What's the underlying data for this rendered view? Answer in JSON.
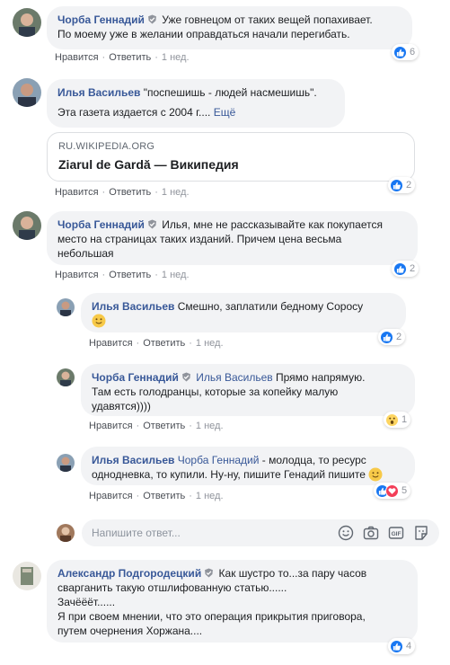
{
  "actions": {
    "like": "Нравится",
    "reply": "Ответить",
    "sep": "·"
  },
  "comments": [
    {
      "author": "Чорба Геннадий",
      "verified": true,
      "lines": [
        "Уже говнецом от таких вещей попахивает.",
        "По моему уже в желании оправдаться начали перегибать."
      ],
      "time": "1 нед.",
      "reaction_count": "6"
    },
    {
      "author": "Илья Васильев",
      "text1": "\"поспешишь - людей насмешишь\".",
      "text2": "Эта газета издается с 2004 г....",
      "more": "Ещё",
      "link": {
        "domain": "RU.WIKIPEDIA.ORG",
        "title": "Ziarul de Gardă — Википедия"
      },
      "time": "1 нед.",
      "reaction_count": "2"
    },
    {
      "author": "Чорба Геннадий",
      "verified": true,
      "line1": "Илья, мне не рассказывайте как покупается",
      "line2": "место на страницах таких изданий. Причем цена весьма",
      "line3": "небольшая",
      "time": "1 нед.",
      "reaction_count": "2"
    }
  ],
  "replies": [
    {
      "author": "Илья Васильев",
      "line1": "Смешно, заплатили бедному Соросу",
      "emoji": "slight-smile",
      "time": "1 нед.",
      "reaction_count": "2"
    },
    {
      "author": "Чорба Геннадий",
      "verified": true,
      "mention": "Илья Васильев",
      "line1": "Прямо напрямую.",
      "line2": "Там есть голодранцы, которые за копейку малую",
      "line3": "удавятся))))",
      "time": "1 нед.",
      "reaction_count": "1"
    },
    {
      "author": "Илья Васильев",
      "mention": "Чорба Геннадий",
      "line1": "- молодца, то ресурс",
      "line2": "однодневка, то купили. Ну-ну, пишите Генадий пишите",
      "emoji": "slight-smile",
      "time": "1 нед.",
      "reaction_count": "5"
    }
  ],
  "reply_box": {
    "placeholder": "Напишите ответ..."
  },
  "last_comment": {
    "author": "Александр Подгородецкий",
    "verified": true,
    "line1": "Как шустро то...за пару часов",
    "line2": "сварганить такую отшлифованную статью......",
    "line3": "Зачёёёт......",
    "line4": "Я при своем мнении, что это операция прикрытия приговора,",
    "line5": "путем очернения Хоржана....",
    "reaction_count": "4"
  },
  "colors": {
    "author": "#385898",
    "bubble": "#f2f3f5",
    "like": "#1877f2",
    "love": "#f33e58",
    "wow": "#fdd561"
  }
}
